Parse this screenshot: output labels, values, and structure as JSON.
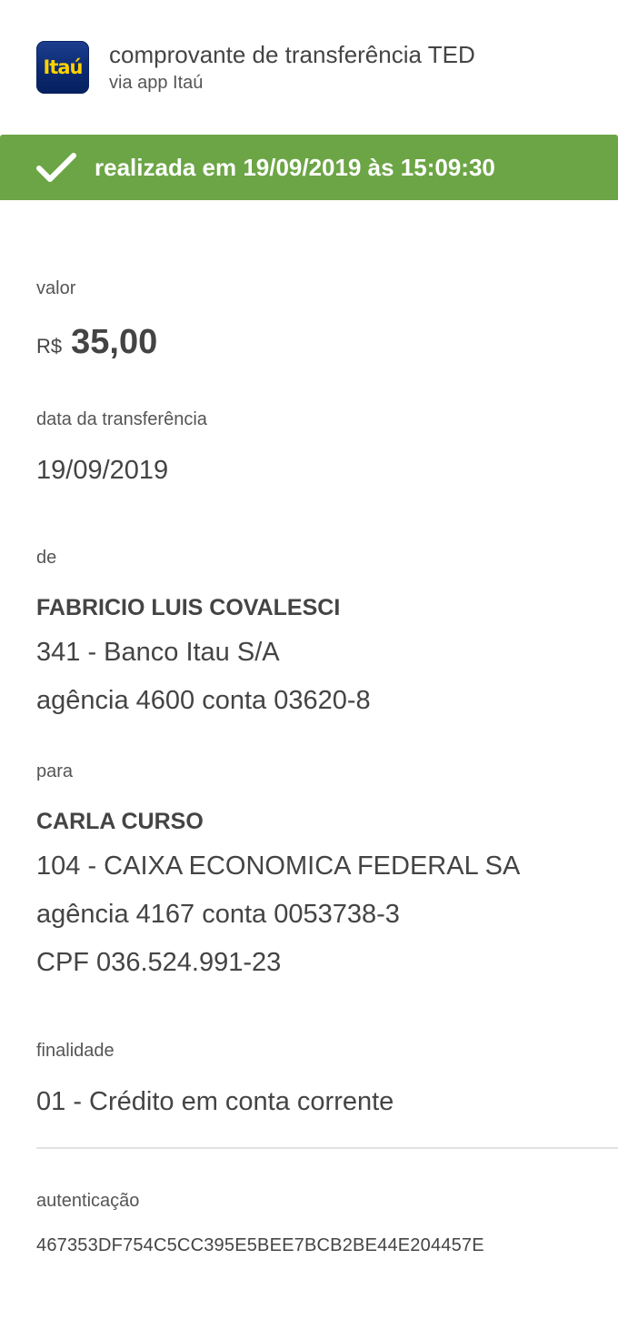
{
  "header": {
    "logo_text": "Itaú",
    "title": "comprovante de transferência TED",
    "subtitle": "via app Itaú"
  },
  "status": {
    "icon": "check-icon",
    "text": "realizada em 19/09/2019 às 15:09:30",
    "color": "#6ca545"
  },
  "valor": {
    "label": "valor",
    "currency": "R$",
    "amount": "35,00"
  },
  "data_transferencia": {
    "label": "data da transferência",
    "value": "19/09/2019"
  },
  "de": {
    "label": "de",
    "name": "FABRICIO LUIS COVALESCI",
    "bank": "341 - Banco Itau S/A",
    "account": "agência 4600 conta 03620-8"
  },
  "para": {
    "label": "para",
    "name": "CARLA CURSO",
    "bank": "104 - CAIXA ECONOMICA FEDERAL SA",
    "account": "agência 4167 conta 0053738-3",
    "cpf": "CPF 036.524.991-23"
  },
  "finalidade": {
    "label": "finalidade",
    "value": "01 - Crédito em conta corrente"
  },
  "autenticacao": {
    "label": "autenticação",
    "value": "467353DF754C5CC395E5BEE7BCB2BE44E204457E"
  }
}
